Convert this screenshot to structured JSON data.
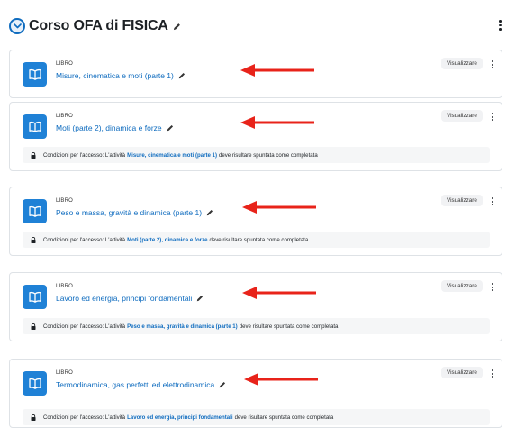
{
  "section": {
    "title": "Corso OFA di FISICA"
  },
  "activities": [
    {
      "type": "LIBRO",
      "name": "Misure, cinematica e moti (parte 1)",
      "view": "Visualizzare"
    },
    {
      "type": "LIBRO",
      "name": "Moti (parte 2), dinamica e forze",
      "view": "Visualizzare",
      "restriction": {
        "prefix": "Condizioni per l'accesso: L'attività",
        "link": "Misure, cinematica e moti (parte 1)",
        "suffix": "deve risultare spuntata come completata"
      }
    },
    {
      "type": "LIBRO",
      "name": "Peso e massa, gravità e dinamica (parte 1)",
      "view": "Visualizzare",
      "restriction": {
        "prefix": "Condizioni per l'accesso: L'attività",
        "link": "Moti (parte 2), dinamica e forze",
        "suffix": "deve risultare spuntata come completata"
      }
    },
    {
      "type": "LIBRO",
      "name": "Lavoro ed energia, principi fondamentali",
      "view": "Visualizzare",
      "restriction": {
        "prefix": "Condizioni per l'accesso: L'attività",
        "link": "Peso e massa, gravità e dinamica (parte 1)",
        "suffix": "deve risultare spuntata come completata"
      }
    },
    {
      "type": "LIBRO",
      "name": "Termodinamica, gas perfetti ed elettrodinamica",
      "view": "Visualizzare",
      "restriction": {
        "prefix": "Condizioni per l'accesso: L'attività",
        "link": "Lavoro ed energia, principi fondamentali",
        "suffix": "deve risultare spuntata come completata"
      }
    }
  ],
  "colors": {
    "accent": "#0f6cbf",
    "icon_bg": "#1f81d6",
    "annotation_arrow": "#e8231a"
  },
  "icons": {
    "collapse": "chevron-down-icon",
    "activity": "book-icon",
    "edit": "pencil-icon",
    "menu": "kebab-menu-icon",
    "restriction": "lock-icon",
    "annotation": "red-arrow-annotation"
  }
}
